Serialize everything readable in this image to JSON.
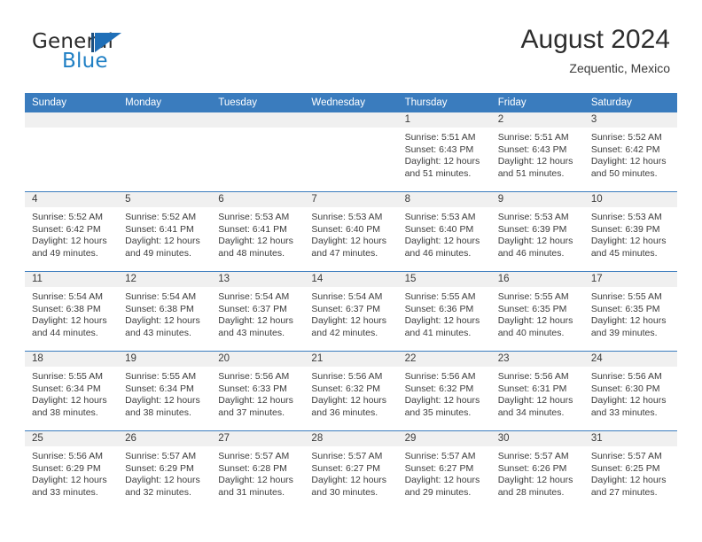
{
  "brand": {
    "word_one": "General",
    "word_two": "Blue",
    "mark": "triangle-flag-logo"
  },
  "header": {
    "title": "August 2024",
    "subtitle": "Zequentic, Mexico"
  },
  "calendar": {
    "weekday_headers": [
      "Sunday",
      "Monday",
      "Tuesday",
      "Wednesday",
      "Thursday",
      "Friday",
      "Saturday"
    ],
    "accent_color": "#3a7cbe",
    "daynum_band_color": "#f0f0f0",
    "weeks": [
      [
        {
          "day": "",
          "sunrise": "",
          "sunset": "",
          "daylight_line1": "",
          "daylight_line2": ""
        },
        {
          "day": "",
          "sunrise": "",
          "sunset": "",
          "daylight_line1": "",
          "daylight_line2": ""
        },
        {
          "day": "",
          "sunrise": "",
          "sunset": "",
          "daylight_line1": "",
          "daylight_line2": ""
        },
        {
          "day": "",
          "sunrise": "",
          "sunset": "",
          "daylight_line1": "",
          "daylight_line2": ""
        },
        {
          "day": "1",
          "sunrise": "Sunrise: 5:51 AM",
          "sunset": "Sunset: 6:43 PM",
          "daylight_line1": "Daylight: 12 hours",
          "daylight_line2": "and 51 minutes."
        },
        {
          "day": "2",
          "sunrise": "Sunrise: 5:51 AM",
          "sunset": "Sunset: 6:43 PM",
          "daylight_line1": "Daylight: 12 hours",
          "daylight_line2": "and 51 minutes."
        },
        {
          "day": "3",
          "sunrise": "Sunrise: 5:52 AM",
          "sunset": "Sunset: 6:42 PM",
          "daylight_line1": "Daylight: 12 hours",
          "daylight_line2": "and 50 minutes."
        }
      ],
      [
        {
          "day": "4",
          "sunrise": "Sunrise: 5:52 AM",
          "sunset": "Sunset: 6:42 PM",
          "daylight_line1": "Daylight: 12 hours",
          "daylight_line2": "and 49 minutes."
        },
        {
          "day": "5",
          "sunrise": "Sunrise: 5:52 AM",
          "sunset": "Sunset: 6:41 PM",
          "daylight_line1": "Daylight: 12 hours",
          "daylight_line2": "and 49 minutes."
        },
        {
          "day": "6",
          "sunrise": "Sunrise: 5:53 AM",
          "sunset": "Sunset: 6:41 PM",
          "daylight_line1": "Daylight: 12 hours",
          "daylight_line2": "and 48 minutes."
        },
        {
          "day": "7",
          "sunrise": "Sunrise: 5:53 AM",
          "sunset": "Sunset: 6:40 PM",
          "daylight_line1": "Daylight: 12 hours",
          "daylight_line2": "and 47 minutes."
        },
        {
          "day": "8",
          "sunrise": "Sunrise: 5:53 AM",
          "sunset": "Sunset: 6:40 PM",
          "daylight_line1": "Daylight: 12 hours",
          "daylight_line2": "and 46 minutes."
        },
        {
          "day": "9",
          "sunrise": "Sunrise: 5:53 AM",
          "sunset": "Sunset: 6:39 PM",
          "daylight_line1": "Daylight: 12 hours",
          "daylight_line2": "and 46 minutes."
        },
        {
          "day": "10",
          "sunrise": "Sunrise: 5:53 AM",
          "sunset": "Sunset: 6:39 PM",
          "daylight_line1": "Daylight: 12 hours",
          "daylight_line2": "and 45 minutes."
        }
      ],
      [
        {
          "day": "11",
          "sunrise": "Sunrise: 5:54 AM",
          "sunset": "Sunset: 6:38 PM",
          "daylight_line1": "Daylight: 12 hours",
          "daylight_line2": "and 44 minutes."
        },
        {
          "day": "12",
          "sunrise": "Sunrise: 5:54 AM",
          "sunset": "Sunset: 6:38 PM",
          "daylight_line1": "Daylight: 12 hours",
          "daylight_line2": "and 43 minutes."
        },
        {
          "day": "13",
          "sunrise": "Sunrise: 5:54 AM",
          "sunset": "Sunset: 6:37 PM",
          "daylight_line1": "Daylight: 12 hours",
          "daylight_line2": "and 43 minutes."
        },
        {
          "day": "14",
          "sunrise": "Sunrise: 5:54 AM",
          "sunset": "Sunset: 6:37 PM",
          "daylight_line1": "Daylight: 12 hours",
          "daylight_line2": "and 42 minutes."
        },
        {
          "day": "15",
          "sunrise": "Sunrise: 5:55 AM",
          "sunset": "Sunset: 6:36 PM",
          "daylight_line1": "Daylight: 12 hours",
          "daylight_line2": "and 41 minutes."
        },
        {
          "day": "16",
          "sunrise": "Sunrise: 5:55 AM",
          "sunset": "Sunset: 6:35 PM",
          "daylight_line1": "Daylight: 12 hours",
          "daylight_line2": "and 40 minutes."
        },
        {
          "day": "17",
          "sunrise": "Sunrise: 5:55 AM",
          "sunset": "Sunset: 6:35 PM",
          "daylight_line1": "Daylight: 12 hours",
          "daylight_line2": "and 39 minutes."
        }
      ],
      [
        {
          "day": "18",
          "sunrise": "Sunrise: 5:55 AM",
          "sunset": "Sunset: 6:34 PM",
          "daylight_line1": "Daylight: 12 hours",
          "daylight_line2": "and 38 minutes."
        },
        {
          "day": "19",
          "sunrise": "Sunrise: 5:55 AM",
          "sunset": "Sunset: 6:34 PM",
          "daylight_line1": "Daylight: 12 hours",
          "daylight_line2": "and 38 minutes."
        },
        {
          "day": "20",
          "sunrise": "Sunrise: 5:56 AM",
          "sunset": "Sunset: 6:33 PM",
          "daylight_line1": "Daylight: 12 hours",
          "daylight_line2": "and 37 minutes."
        },
        {
          "day": "21",
          "sunrise": "Sunrise: 5:56 AM",
          "sunset": "Sunset: 6:32 PM",
          "daylight_line1": "Daylight: 12 hours",
          "daylight_line2": "and 36 minutes."
        },
        {
          "day": "22",
          "sunrise": "Sunrise: 5:56 AM",
          "sunset": "Sunset: 6:32 PM",
          "daylight_line1": "Daylight: 12 hours",
          "daylight_line2": "and 35 minutes."
        },
        {
          "day": "23",
          "sunrise": "Sunrise: 5:56 AM",
          "sunset": "Sunset: 6:31 PM",
          "daylight_line1": "Daylight: 12 hours",
          "daylight_line2": "and 34 minutes."
        },
        {
          "day": "24",
          "sunrise": "Sunrise: 5:56 AM",
          "sunset": "Sunset: 6:30 PM",
          "daylight_line1": "Daylight: 12 hours",
          "daylight_line2": "and 33 minutes."
        }
      ],
      [
        {
          "day": "25",
          "sunrise": "Sunrise: 5:56 AM",
          "sunset": "Sunset: 6:29 PM",
          "daylight_line1": "Daylight: 12 hours",
          "daylight_line2": "and 33 minutes."
        },
        {
          "day": "26",
          "sunrise": "Sunrise: 5:57 AM",
          "sunset": "Sunset: 6:29 PM",
          "daylight_line1": "Daylight: 12 hours",
          "daylight_line2": "and 32 minutes."
        },
        {
          "day": "27",
          "sunrise": "Sunrise: 5:57 AM",
          "sunset": "Sunset: 6:28 PM",
          "daylight_line1": "Daylight: 12 hours",
          "daylight_line2": "and 31 minutes."
        },
        {
          "day": "28",
          "sunrise": "Sunrise: 5:57 AM",
          "sunset": "Sunset: 6:27 PM",
          "daylight_line1": "Daylight: 12 hours",
          "daylight_line2": "and 30 minutes."
        },
        {
          "day": "29",
          "sunrise": "Sunrise: 5:57 AM",
          "sunset": "Sunset: 6:27 PM",
          "daylight_line1": "Daylight: 12 hours",
          "daylight_line2": "and 29 minutes."
        },
        {
          "day": "30",
          "sunrise": "Sunrise: 5:57 AM",
          "sunset": "Sunset: 6:26 PM",
          "daylight_line1": "Daylight: 12 hours",
          "daylight_line2": "and 28 minutes."
        },
        {
          "day": "31",
          "sunrise": "Sunrise: 5:57 AM",
          "sunset": "Sunset: 6:25 PM",
          "daylight_line1": "Daylight: 12 hours",
          "daylight_line2": "and 27 minutes."
        }
      ]
    ]
  }
}
